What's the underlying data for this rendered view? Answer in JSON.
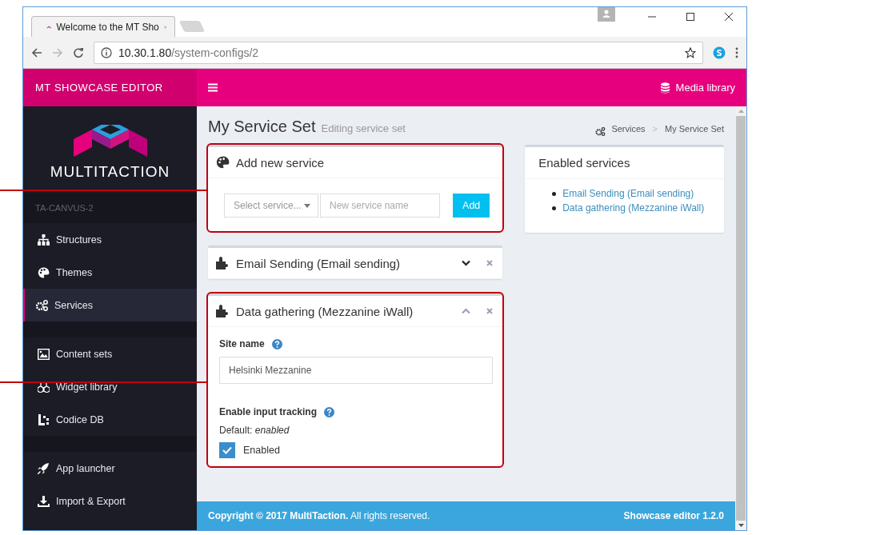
{
  "browser": {
    "tabs": [
      {
        "title": "Welcome to the MT Sho",
        "selected": true
      }
    ],
    "url_host": "10.30.1.80",
    "url_path": "/system-configs/2"
  },
  "header": {
    "brand": "**MT** SHOWCASE **EDITOR**",
    "media_library": "Media library"
  },
  "sidebar": {
    "brand": "**MULTI**TACTION",
    "device": "TA-CANVUS-2",
    "groups": [
      [
        {
          "label": "Structures",
          "selected": false
        },
        {
          "label": "Themes",
          "selected": false
        },
        {
          "label": "Services",
          "selected": true
        }
      ],
      [
        {
          "label": "Content sets",
          "selected": false
        },
        {
          "label": "Widget library",
          "selected": false
        },
        {
          "label": "Codice DB",
          "selected": false
        }
      ],
      [
        {
          "label": "App launcher",
          "selected": false
        },
        {
          "label": "Import & Export",
          "selected": false
        }
      ]
    ]
  },
  "page": {
    "title": "My Service Set",
    "subtitle": "Editing service set",
    "breadcrumb": [
      "Services",
      "My Service Set"
    ],
    "breadcrumb_separator": ">"
  },
  "add_card": {
    "title": "Add new service",
    "highlighted": true,
    "select_placeholder": "Select service...",
    "name_placeholder": "New service name",
    "button": "Add"
  },
  "services": [
    {
      "title": "Email Sending (Email sending)",
      "expanded": false,
      "highlighted": false
    },
    {
      "title": "Data gathering (Mezzanine iWall)",
      "expanded": true,
      "highlighted": true,
      "fields": [
        {
          "kind": "text",
          "label": "Site name",
          "value": "Helsinki Mezzanine"
        },
        {
          "kind": "checkbox",
          "label": "Enable input tracking",
          "default": "Default: *enabled*",
          "checked": true,
          "option": "Enabled"
        }
      ]
    }
  ],
  "enabled_services": {
    "title": "Enabled services",
    "items": [
      "Email Sending (Email sending)",
      "Data gathering (Mezzanine iWall)"
    ]
  },
  "footer": {
    "copyright": "**Copyright © 2017 MultiTaction.** All rights reserved.",
    "version": "Showcase editor 1.2.0"
  }
}
